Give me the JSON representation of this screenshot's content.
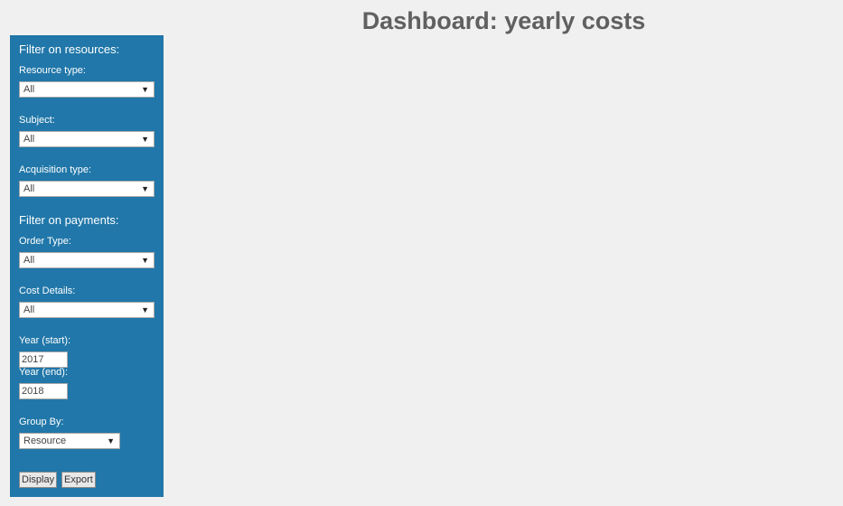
{
  "header": {
    "title": "Dashboard: yearly costs"
  },
  "sidebar": {
    "resources_title": "Filter on resources:",
    "resource_type": {
      "label": "Resource type:",
      "value": "All"
    },
    "subject": {
      "label": "Subject:",
      "value": "All"
    },
    "acquisition_type": {
      "label": "Acquisition type:",
      "value": "All"
    },
    "payments_title": "Filter on payments:",
    "order_type": {
      "label": "Order Type:",
      "value": "All"
    },
    "cost_details": {
      "label": "Cost Details:",
      "value": "All"
    },
    "year_start": {
      "label": "Year (start):",
      "value": "2017"
    },
    "year_end": {
      "label": "Year (end):",
      "value": "2018"
    },
    "group_by": {
      "label": "Group By:",
      "value": "Resource"
    },
    "display_label": "Display",
    "export_label": "Export"
  },
  "colors": {
    "sidebar_bg": "#2177a9",
    "page_bg": "#f0f0f0"
  },
  "icons": {
    "dropdown": "dropdown-arrow-icon"
  }
}
